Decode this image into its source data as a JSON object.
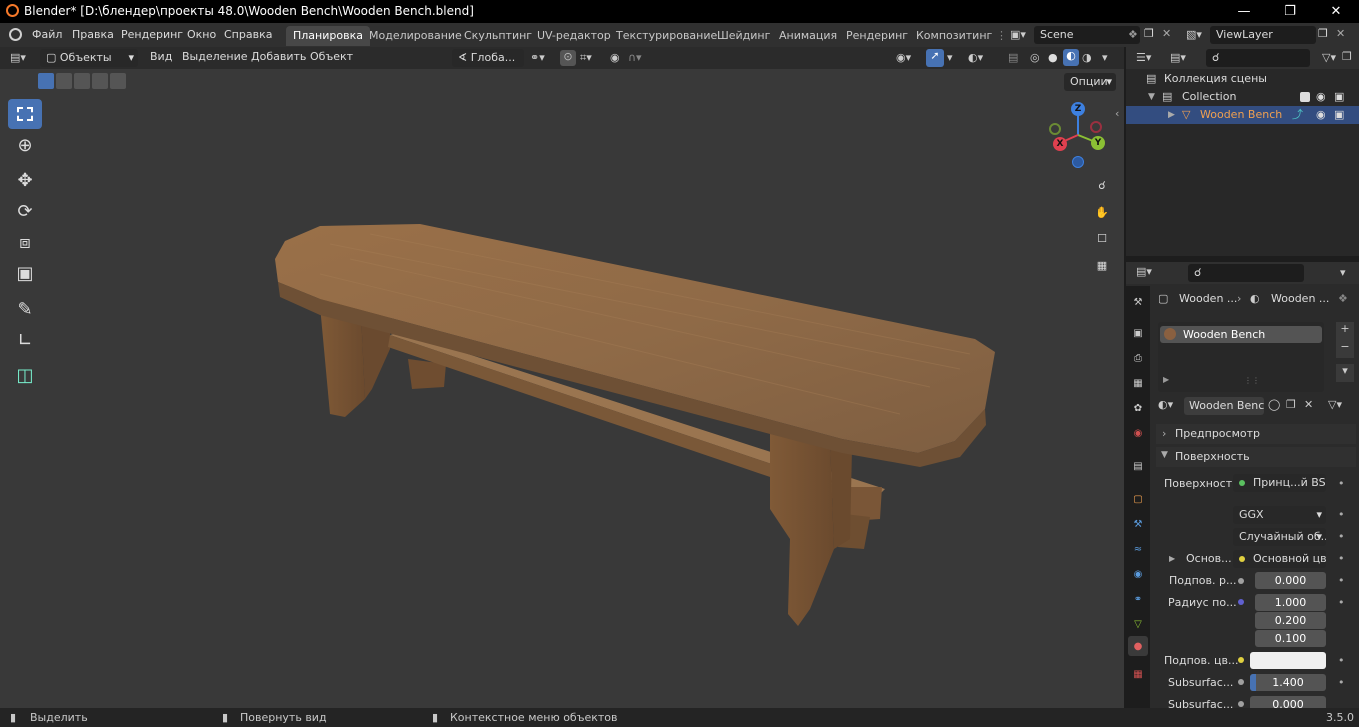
{
  "title": "Blender* [D:\\блендер\\проекты 48.0\\Wooden Bench\\Wooden Bench.blend]",
  "menu": [
    "Файл",
    "Правка",
    "Рендеринг",
    "Окно",
    "Справка"
  ],
  "workspaces": [
    "Планировка",
    "Моделирование",
    "Скульптинг",
    "UV-редактор",
    "Текстурирование",
    "Шейдинг",
    "Анимация",
    "Рендеринг",
    "Композитинг"
  ],
  "scene": "Scene",
  "view_layer": "ViewLayer",
  "viewport": {
    "mode": "Объекты",
    "menus": [
      "Вид",
      "Выделение",
      "Добавить",
      "Объект"
    ],
    "orientation": "Глоба...",
    "options": "Опции",
    "gizmo_axes": {
      "x": "X",
      "y": "Y",
      "z": "Z"
    }
  },
  "outliner": {
    "scene_collection": "Коллекция сцены",
    "collection": "Collection",
    "object": "Wooden Bench"
  },
  "properties": {
    "breadcrumb_1": "Wooden ...",
    "breadcrumb_2": "Wooden ...",
    "material_slot": "Wooden Bench",
    "material_name": "Wooden Bench",
    "panel_preview": "Предпросмотр",
    "panel_surface": "Поверхность",
    "surface_label": "Поверхность",
    "surface_value": "Принц...й BSDF",
    "distribution": "GGX",
    "subsurface_method": "Случайный об...",
    "base_label": "Основ...",
    "base_value": "Основной цвет",
    "subsurface_label": "Подпов. р...",
    "subsurface_value": "0.000",
    "radius_label": "Радиус по...",
    "radius_values": [
      "1.000",
      "0.200",
      "0.100"
    ],
    "subsurface_color_label": "Подпов. цв...",
    "ior_label": "Subsurfac...",
    "ior_value": "1.400",
    "aniso_label": "Subsurfac...",
    "aniso_value": "0.000"
  },
  "status": {
    "select": "Выделить",
    "rotate": "Повернуть вид",
    "context": "Контекстное меню объектов",
    "version": "3.5.0"
  },
  "colors": {
    "accent": "#4772b3",
    "selected_row": "#334d80",
    "object_name": "#f0a050",
    "axis_x": "#e0404f",
    "axis_y": "#8bc034",
    "axis_z": "#3d80e0"
  }
}
